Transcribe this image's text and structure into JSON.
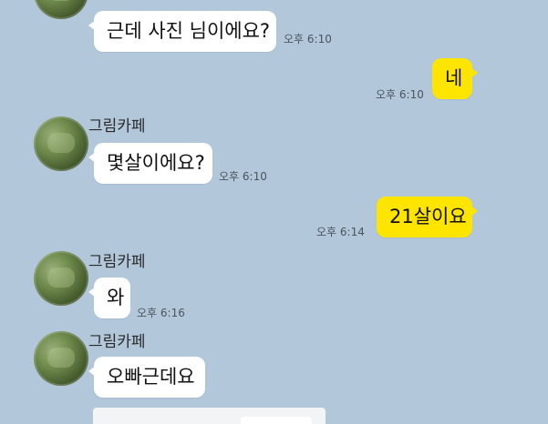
{
  "messages": [
    {
      "side": "in",
      "text": "근데 사진 님이에요?",
      "time": "오후 6:10"
    },
    {
      "side": "out",
      "text": "네",
      "time": "오후 6:10"
    },
    {
      "side": "in",
      "sender": "그림카페",
      "text": "몇살이에요?",
      "time": "오후 6:10"
    },
    {
      "side": "out",
      "text": "21살이요",
      "time": "오후 6:14"
    },
    {
      "side": "in",
      "sender": "그림카페",
      "text": "와",
      "time": "오후 6:16"
    },
    {
      "side": "in",
      "sender": "그림카페",
      "text": "오빠근데요"
    }
  ],
  "colors": {
    "background": "#b2c7d9",
    "incoming_bubble": "#ffffff",
    "outgoing_bubble": "#fee500"
  }
}
